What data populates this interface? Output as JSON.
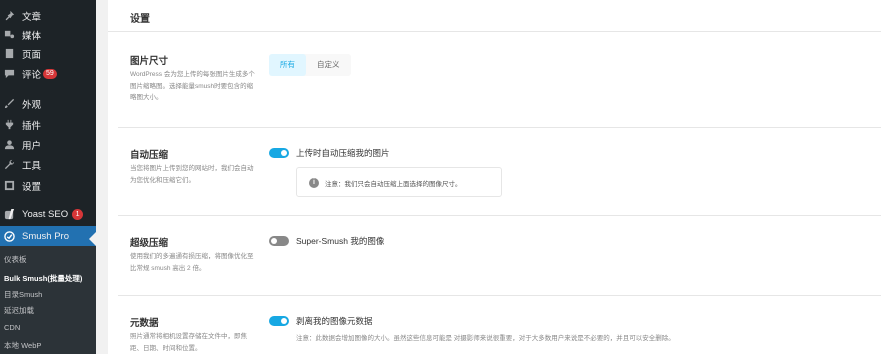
{
  "sidebar": {
    "items": [
      {
        "label": "文章",
        "icon": "pin-icon"
      },
      {
        "label": "媒体",
        "icon": "media-icon"
      },
      {
        "label": "页面",
        "icon": "page-icon"
      },
      {
        "label": "评论",
        "icon": "comment-icon",
        "badge": "59"
      },
      {
        "label": "外观",
        "icon": "appearance-icon"
      },
      {
        "label": "插件",
        "icon": "plugin-icon"
      },
      {
        "label": "用户",
        "icon": "user-icon"
      },
      {
        "label": "工具",
        "icon": "wrench-icon"
      },
      {
        "label": "设置",
        "icon": "settings-icon"
      },
      {
        "label": "Yoast SEO",
        "icon": "yoast-icon",
        "badge": "1"
      },
      {
        "label": "Smush Pro",
        "icon": "smush-icon"
      }
    ],
    "submenu": [
      {
        "label": "仪表板"
      },
      {
        "label": "Bulk Smush(批量处理)"
      },
      {
        "label": "目录Smush"
      },
      {
        "label": "延迟加载"
      },
      {
        "label": "CDN"
      },
      {
        "label": "本地 WebP"
      }
    ],
    "colors": {
      "bg": "#1d2327",
      "active": "#2271b1",
      "badge": "#d63638"
    }
  },
  "main": {
    "title": "设置",
    "image_sizes": {
      "label": "图片尺寸",
      "desc": "WordPress 会为您上传的每张图片生成多个图片缩略图。选择能量smush时要包含的缩略图大小。",
      "tabs": [
        "所有",
        "自定义"
      ],
      "selected_tab": "所有"
    },
    "auto_compress": {
      "label": "自动压缩",
      "desc": "当您将图片上传到您的网站时，我们会自动为您优化和压缩它们。",
      "toggle_label": "上传时自动压缩我的图片",
      "enabled": true,
      "notice": "注意：我们只会自动压缩上面选择的图像尺寸。"
    },
    "super_smush": {
      "label": "超级压缩",
      "desc": "使用我们的多遍通有损压缩，将图像优化至比常规 smush 高出 2 倍。",
      "toggle_label": "Super-Smush 我的图像",
      "enabled": false
    },
    "metadata": {
      "label": "元数据",
      "desc": "照片通常将相机设置存储在文件中，即焦距、日期、时间和位置。",
      "toggle_label": "剥离我的图像元数据",
      "enabled": true,
      "note": "注意：此数据会增加图像的大小。虽然这些信息可能是 对摄影师来说很重要，对于大多数用户来说是不必要的，并且可以安全删除。"
    },
    "accent_color": "#17a8e3"
  }
}
